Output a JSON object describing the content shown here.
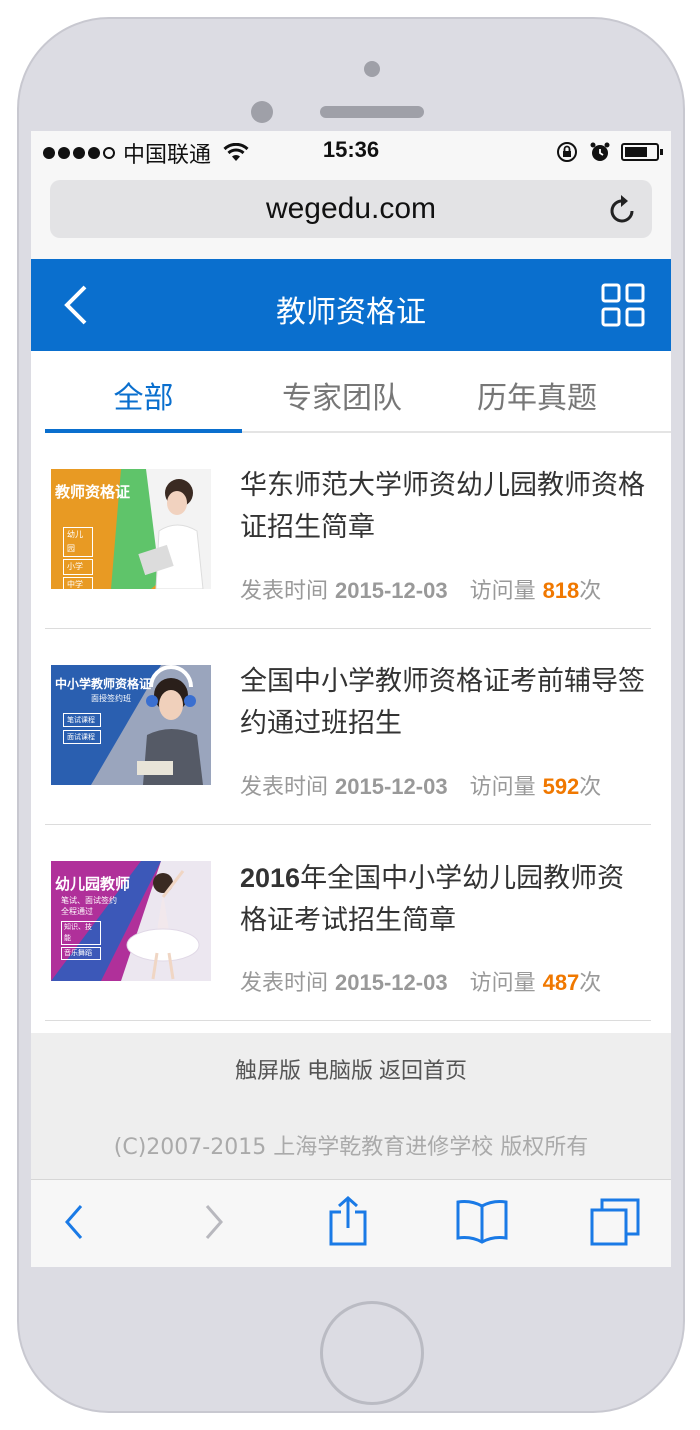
{
  "status_bar": {
    "carrier": "中国联通",
    "time": "15:36",
    "signal_dots_filled": 4
  },
  "browser": {
    "url": "wegedu.com"
  },
  "app_bar": {
    "title": "教师资格证",
    "back_icon": "chevron-left-icon",
    "menu_icon": "grid-icon"
  },
  "tabs": [
    {
      "label": "全部",
      "active": true
    },
    {
      "label": "专家团队",
      "active": false
    },
    {
      "label": "历年真题",
      "active": false
    }
  ],
  "articles": [
    {
      "title": "华东师范大学师资幼儿园教师资格证招生简章",
      "date_label": "发表时间",
      "date": "2015-12-03",
      "views_label": "访问量",
      "views": "818",
      "views_unit": "次",
      "thumb": {
        "heading": "教师资格证",
        "tags": [
          "幼儿园",
          "小学",
          "中学"
        ],
        "colors": {
          "primary": "#e89a23",
          "secondary": "#5fc46a"
        }
      }
    },
    {
      "title": "全国中小学教师资格证考前辅导签约通过班招生",
      "date_label": "发表时间",
      "date": "2015-12-03",
      "views_label": "访问量",
      "views": "592",
      "views_unit": "次",
      "thumb": {
        "heading": "中小学教师资格证",
        "subheading": "面授签约班",
        "tags": [
          "笔试课程",
          "面试课程"
        ],
        "colors": {
          "primary": "#2a5fb0",
          "secondary": "#8d9bb8"
        }
      }
    },
    {
      "title_bold_prefix": "2016",
      "title": "年全国中小学幼儿园教师资格证考试招生简章",
      "date_label": "发表时间",
      "date": "2015-12-03",
      "views_label": "访问量",
      "views": "487",
      "views_unit": "次",
      "thumb": {
        "heading": "幼儿园教师",
        "subheading": "笔试、面试签约",
        "subheading2": "全程通过",
        "tags": [
          "知识、技能",
          "音乐舞蹈"
        ],
        "colors": {
          "primary": "#b0309a",
          "secondary": "#3c58b8"
        }
      }
    }
  ],
  "footer": {
    "links": [
      "触屏版",
      "电脑版",
      "返回首页"
    ],
    "copyright": "(C)2007-2015 上海学乾教育进修学校 版权所有"
  },
  "toolbar": {
    "icons": [
      "back-arrow-icon",
      "forward-arrow-icon",
      "share-icon",
      "bookmarks-icon",
      "tabs-icon"
    ]
  },
  "colors": {
    "brand_blue": "#0a6fce",
    "views_orange": "#f07800",
    "ios_blue": "#1a7ae6"
  }
}
